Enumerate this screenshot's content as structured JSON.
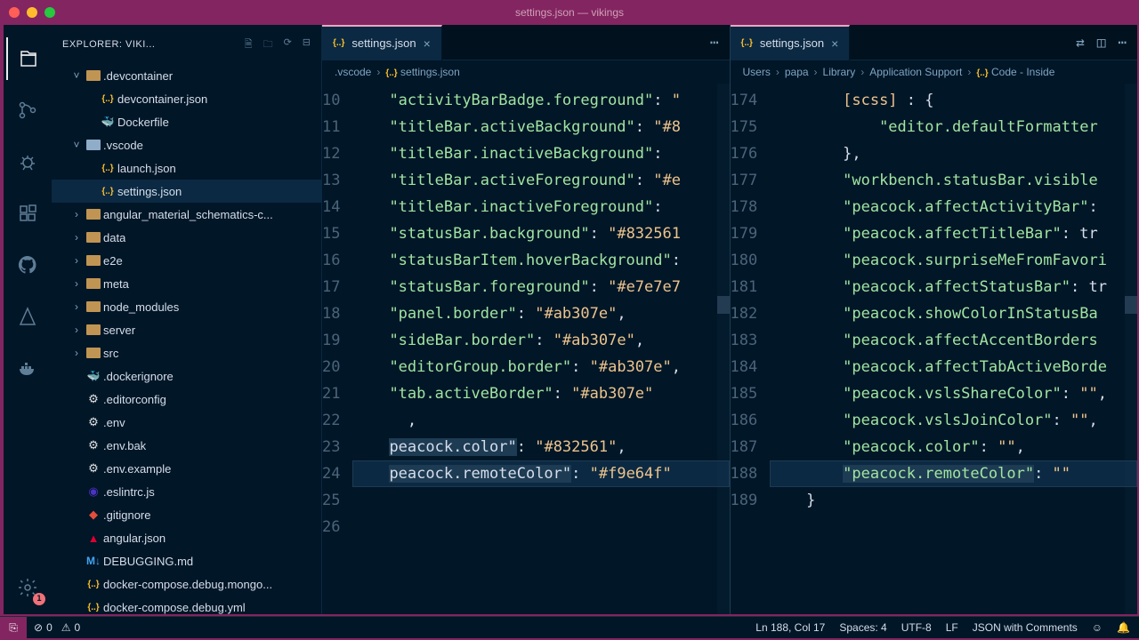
{
  "window": {
    "title": "settings.json — vikings"
  },
  "explorer": {
    "header": "EXPLORER: VIKI...",
    "tree": [
      {
        "kind": "folder",
        "label": ".devcontainer",
        "expanded": true,
        "children": [
          {
            "kind": "file",
            "icon": "json",
            "label": "devcontainer.json"
          },
          {
            "kind": "file",
            "icon": "docker",
            "label": "Dockerfile"
          }
        ]
      },
      {
        "kind": "folder",
        "label": ".vscode",
        "expanded": true,
        "open": true,
        "children": [
          {
            "kind": "file",
            "icon": "json",
            "label": "launch.json"
          },
          {
            "kind": "file",
            "icon": "json",
            "label": "settings.json",
            "selected": true
          }
        ]
      },
      {
        "kind": "folder",
        "label": "angular_material_schematics-c..."
      },
      {
        "kind": "folder",
        "label": "data"
      },
      {
        "kind": "folder",
        "label": "e2e"
      },
      {
        "kind": "folder",
        "label": "meta"
      },
      {
        "kind": "folder",
        "label": "node_modules"
      },
      {
        "kind": "folder",
        "label": "server"
      },
      {
        "kind": "folder",
        "label": "src"
      },
      {
        "kind": "file",
        "icon": "docker",
        "label": ".dockerignore"
      },
      {
        "kind": "file",
        "icon": "gear",
        "label": ".editorconfig"
      },
      {
        "kind": "file",
        "icon": "gear",
        "label": ".env"
      },
      {
        "kind": "file",
        "icon": "gear",
        "label": ".env.bak"
      },
      {
        "kind": "file",
        "icon": "gear",
        "label": ".env.example"
      },
      {
        "kind": "file",
        "icon": "eslint",
        "label": ".eslintrc.js"
      },
      {
        "kind": "file",
        "icon": "git",
        "label": ".gitignore"
      },
      {
        "kind": "file",
        "icon": "ng",
        "label": "angular.json"
      },
      {
        "kind": "file",
        "icon": "md",
        "label": "DEBUGGING.md"
      },
      {
        "kind": "file",
        "icon": "json",
        "label": "docker-compose.debug.mongo..."
      },
      {
        "kind": "file",
        "icon": "json",
        "label": "docker-compose.debug.yml"
      }
    ]
  },
  "editors": {
    "left": {
      "tab": {
        "icon": "json",
        "label": "settings.json",
        "close": "×",
        "modified": false
      },
      "breadcrumb": [
        ".vscode",
        "settings.json"
      ],
      "startLine": 10,
      "lines": [
        [
          {
            "k": true,
            "t": "\"activityBarBadge.foreground\""
          },
          {
            "t": ": "
          },
          {
            "s": true,
            "t": "\""
          }
        ],
        [
          {
            "k": true,
            "t": "\"titleBar.activeBackground\""
          },
          {
            "t": ": "
          },
          {
            "s": true,
            "t": "\"#8"
          }
        ],
        [
          {
            "k": true,
            "t": "\"titleBar.inactiveBackground\""
          },
          {
            "t": ": "
          }
        ],
        [
          {
            "k": true,
            "t": "\"titleBar.activeForeground\""
          },
          {
            "t": ": "
          },
          {
            "s": true,
            "t": "\"#e"
          }
        ],
        [
          {
            "k": true,
            "t": "\"titleBar.inactiveForeground\""
          },
          {
            "t": ": "
          }
        ],
        [
          {
            "k": true,
            "t": "\"statusBar.background\""
          },
          {
            "t": ": "
          },
          {
            "s": true,
            "t": "\"#832561"
          }
        ],
        [
          {
            "k": true,
            "t": "\"statusBarItem.hoverBackground\""
          },
          {
            "t": ":"
          }
        ],
        [
          {
            "k": true,
            "t": "\"statusBar.foreground\""
          },
          {
            "t": ": "
          },
          {
            "s": true,
            "t": "\"#e7e7e7"
          }
        ],
        [
          {
            "k": true,
            "t": "\"panel.border\""
          },
          {
            "t": ": "
          },
          {
            "s": true,
            "t": "\"#ab307e\""
          },
          {
            "t": ","
          }
        ],
        [
          {
            "k": true,
            "t": "\"sideBar.border\""
          },
          {
            "t": ": "
          },
          {
            "s": true,
            "t": "\"#ab307e\""
          },
          {
            "t": ","
          }
        ],
        [
          {
            "k": true,
            "t": "\"editorGroup.border\""
          },
          {
            "t": ": "
          },
          {
            "s": true,
            "t": "\"#ab307e\""
          },
          {
            "t": ","
          }
        ],
        [
          {
            "k": true,
            "t": "\"tab.activeBorder\""
          },
          {
            "t": ": "
          },
          {
            "s": true,
            "t": "\"#ab307e\""
          }
        ],
        [
          {
            "t": "  ,"
          }
        ],
        [
          {
            "sel": true,
            "t": "peacock.color\""
          },
          {
            "t": ": "
          },
          {
            "s": true,
            "t": "\"#832561\""
          },
          {
            "t": ","
          }
        ],
        [
          {
            "sel": true,
            "t": "peacock.remoteColor\""
          },
          {
            "t": ": "
          },
          {
            "s": true,
            "t": "\"#f9e64f\""
          }
        ],
        [
          {
            "t": ""
          }
        ],
        [
          {
            "t": ""
          }
        ]
      ],
      "highlight": 24
    },
    "right": {
      "tab": {
        "icon": "json",
        "label": "settings.json",
        "close": "×"
      },
      "breadcrumb": [
        "Users",
        "papa",
        "Library",
        "Application Support",
        "Code - Inside"
      ],
      "startLine": 174,
      "lines": [
        [
          {
            "t": "    "
          },
          {
            "s": true,
            "t": "[scss]"
          },
          {
            "t": " : {"
          }
        ],
        [
          {
            "t": "        "
          },
          {
            "k": true,
            "t": "\"editor.defaultFormatter"
          }
        ],
        [
          {
            "t": "    },"
          }
        ],
        [
          {
            "t": "    "
          },
          {
            "k": true,
            "t": "\"workbench.statusBar.visible"
          }
        ],
        [
          {
            "t": "    "
          },
          {
            "k": true,
            "t": "\"peacock.affectActivityBar\""
          },
          {
            "t": ":"
          }
        ],
        [
          {
            "t": "    "
          },
          {
            "k": true,
            "t": "\"peacock.affectTitleBar\""
          },
          {
            "t": ": tr"
          }
        ],
        [
          {
            "t": "    "
          },
          {
            "k": true,
            "t": "\"peacock.surpriseMeFromFavori"
          }
        ],
        [
          {
            "t": "    "
          },
          {
            "k": true,
            "t": "\"peacock.affectStatusBar\""
          },
          {
            "t": ": tr"
          }
        ],
        [
          {
            "t": "    "
          },
          {
            "k": true,
            "t": "\"peacock.showColorInStatusBa"
          }
        ],
        [
          {
            "t": "    "
          },
          {
            "k": true,
            "t": "\"peacock.affectAccentBorders"
          }
        ],
        [
          {
            "t": "    "
          },
          {
            "k": true,
            "t": "\"peacock.affectTabActiveBorde"
          }
        ],
        [
          {
            "t": "    "
          },
          {
            "k": true,
            "t": "\"peacock.vslsShareColor\""
          },
          {
            "t": ": "
          },
          {
            "s": true,
            "t": "\"\""
          },
          {
            "t": ","
          }
        ],
        [
          {
            "t": "    "
          },
          {
            "k": true,
            "t": "\"peacock.vslsJoinColor\""
          },
          {
            "t": ": "
          },
          {
            "s": true,
            "t": "\"\""
          },
          {
            "t": ","
          }
        ],
        [
          {
            "t": "    "
          },
          {
            "k": true,
            "t": "\"peacock.color\""
          },
          {
            "t": ": "
          },
          {
            "s": true,
            "t": "\"\""
          },
          {
            "t": ","
          }
        ],
        [
          {
            "t": "    "
          },
          {
            "k": true,
            "sel": true,
            "t": "\"peacock.remoteColor\""
          },
          {
            "t": ": "
          },
          {
            "s": true,
            "t": "\"\""
          }
        ],
        [
          {
            "t": "}"
          }
        ]
      ],
      "highlight": 188
    }
  },
  "statusbar": {
    "errors": "0",
    "warnings": "0",
    "cursor": "Ln 188, Col 17",
    "spaces": "Spaces: 4",
    "encoding": "UTF-8",
    "eol": "LF",
    "lang": "JSON with Comments"
  },
  "act_badge": "1"
}
